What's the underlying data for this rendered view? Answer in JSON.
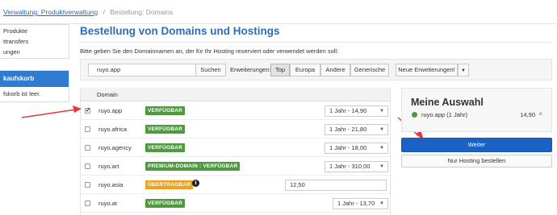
{
  "breadcrumb": {
    "link": "Verwaltung: Produktverwaltung",
    "separator": "/",
    "current": "Bestellung: Domains"
  },
  "sidebar": {
    "items": [
      {
        "label": "Produkte"
      },
      {
        "label": "ttransfers"
      },
      {
        "label": "ungen"
      }
    ],
    "cart": {
      "header": "kaufskorb",
      "body": "fskorb ist leer."
    }
  },
  "main": {
    "title": "Bestellung von Domains und Hostings",
    "intro": "Bitte geben Sie den Domainnamen an, der für Ihr Hosting reserviert oder verwendet werden soll:"
  },
  "search": {
    "value": "ruyo.app",
    "button": "Suchen",
    "extensions_label": "Erweiterungen:",
    "tabs": [
      {
        "label": "Top",
        "active": true
      },
      {
        "label": "Europa",
        "active": false
      },
      {
        "label": "Andere",
        "active": false
      },
      {
        "label": "Generische",
        "active": false
      },
      {
        "label": "Neue Erweiterungen!",
        "active": false
      }
    ],
    "dropdown_icon": "caret-down-icon"
  },
  "table": {
    "header": "Domain",
    "rows": [
      {
        "domain": "ruyo.app",
        "checked": true,
        "status": "VERFÜGBAR",
        "status_color": "#4f9a3e",
        "option": "1 Jahr - 14,90"
      },
      {
        "domain": "ruyo.africa",
        "checked": false,
        "status": "VERFÜGBAR",
        "status_color": "#4f9a3e",
        "option": "1 Jahr - 21,80"
      },
      {
        "domain": "ruyo.agency",
        "checked": false,
        "status": "VERFÜGBAR",
        "status_color": "#4f9a3e",
        "option": "1 Jahr - 18,00"
      },
      {
        "domain": "ruyo.art",
        "checked": false,
        "status": "PREMIUM-DOMAIN : VERFÜGBAR",
        "status_color": "#4f9a3e",
        "option": "1 Jahr - 310,00"
      },
      {
        "domain": "ruyo.asia",
        "checked": false,
        "status": "ÜBERTRAGBAR",
        "status_color": "#f0a020",
        "option": "12,50"
      },
      {
        "domain": "ruyo.at",
        "checked": false,
        "status": "VERFÜGBAR",
        "status_color": "#4f9a3e",
        "option": "1 Jahr - 13,70"
      }
    ]
  },
  "summary": {
    "title": "Meine Auswahl",
    "item": "ruyo.app (1 Jahr)",
    "price": "14,90",
    "remove": "×"
  },
  "actions": {
    "continue": "Weiter",
    "no_hosting": "Nur Hosting bestellen"
  },
  "colors": {
    "accent": "#2e6eb5",
    "primary_button": "#1a62c4",
    "available": "#4f9a3e",
    "transferable": "#f0a020",
    "annotation_arrow": "#e23a3a"
  }
}
